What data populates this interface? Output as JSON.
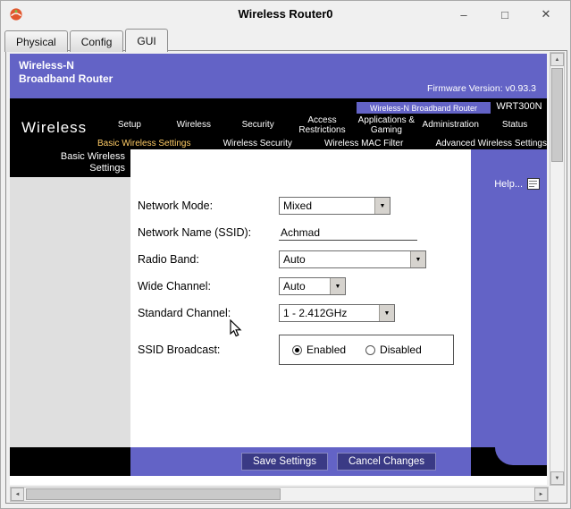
{
  "window": {
    "title": "Wireless Router0"
  },
  "icons": {
    "minimize": "–",
    "maximize": "□",
    "close": "✕",
    "dropdown_arrow": "▼",
    "scroll_up": "▲",
    "scroll_down": "▼",
    "scroll_left": "◄",
    "scroll_right": "►"
  },
  "tabs": [
    {
      "label": "Physical",
      "active": false
    },
    {
      "label": "Config",
      "active": false
    },
    {
      "label": "GUI",
      "active": true
    }
  ],
  "router": {
    "header": {
      "title_line1": "Wireless-N",
      "title_line2": "Broadband Router",
      "firmware": "Firmware Version: v0.93.3"
    },
    "brand": "Wireless",
    "model_strip": {
      "label": "Wireless-N Broadband Router",
      "model": "WRT300N"
    },
    "nav": [
      "Setup",
      "Wireless",
      "Security",
      "Access Restrictions",
      "Applications & Gaming",
      "Administration",
      "Status"
    ],
    "subnav": [
      "Basic Wireless Settings",
      "Wireless Security",
      "Wireless MAC Filter",
      "Advanced Wireless Settings"
    ],
    "sidebar_label": "Basic Wireless Settings",
    "help_label": "Help...",
    "form": {
      "network_mode": {
        "label": "Network Mode:",
        "value": "Mixed"
      },
      "ssid": {
        "label": "Network Name (SSID):",
        "value": "Achmad"
      },
      "radio_band": {
        "label": "Radio Band:",
        "value": "Auto"
      },
      "wide_channel": {
        "label": "Wide Channel:",
        "value": "Auto"
      },
      "standard_channel": {
        "label": "Standard Channel:",
        "value": "1 - 2.412GHz"
      },
      "ssid_broadcast": {
        "label": "SSID Broadcast:",
        "enabled": "Enabled",
        "disabled": "Disabled",
        "selected": "Enabled"
      }
    },
    "footer": {
      "save": "Save Settings",
      "cancel": "Cancel Changes"
    }
  },
  "colors": {
    "linksys_purple": "#6363C6",
    "button_navy": "#3A3A85",
    "subnav_active": "#FFCC66",
    "nav_black": "#000000"
  }
}
